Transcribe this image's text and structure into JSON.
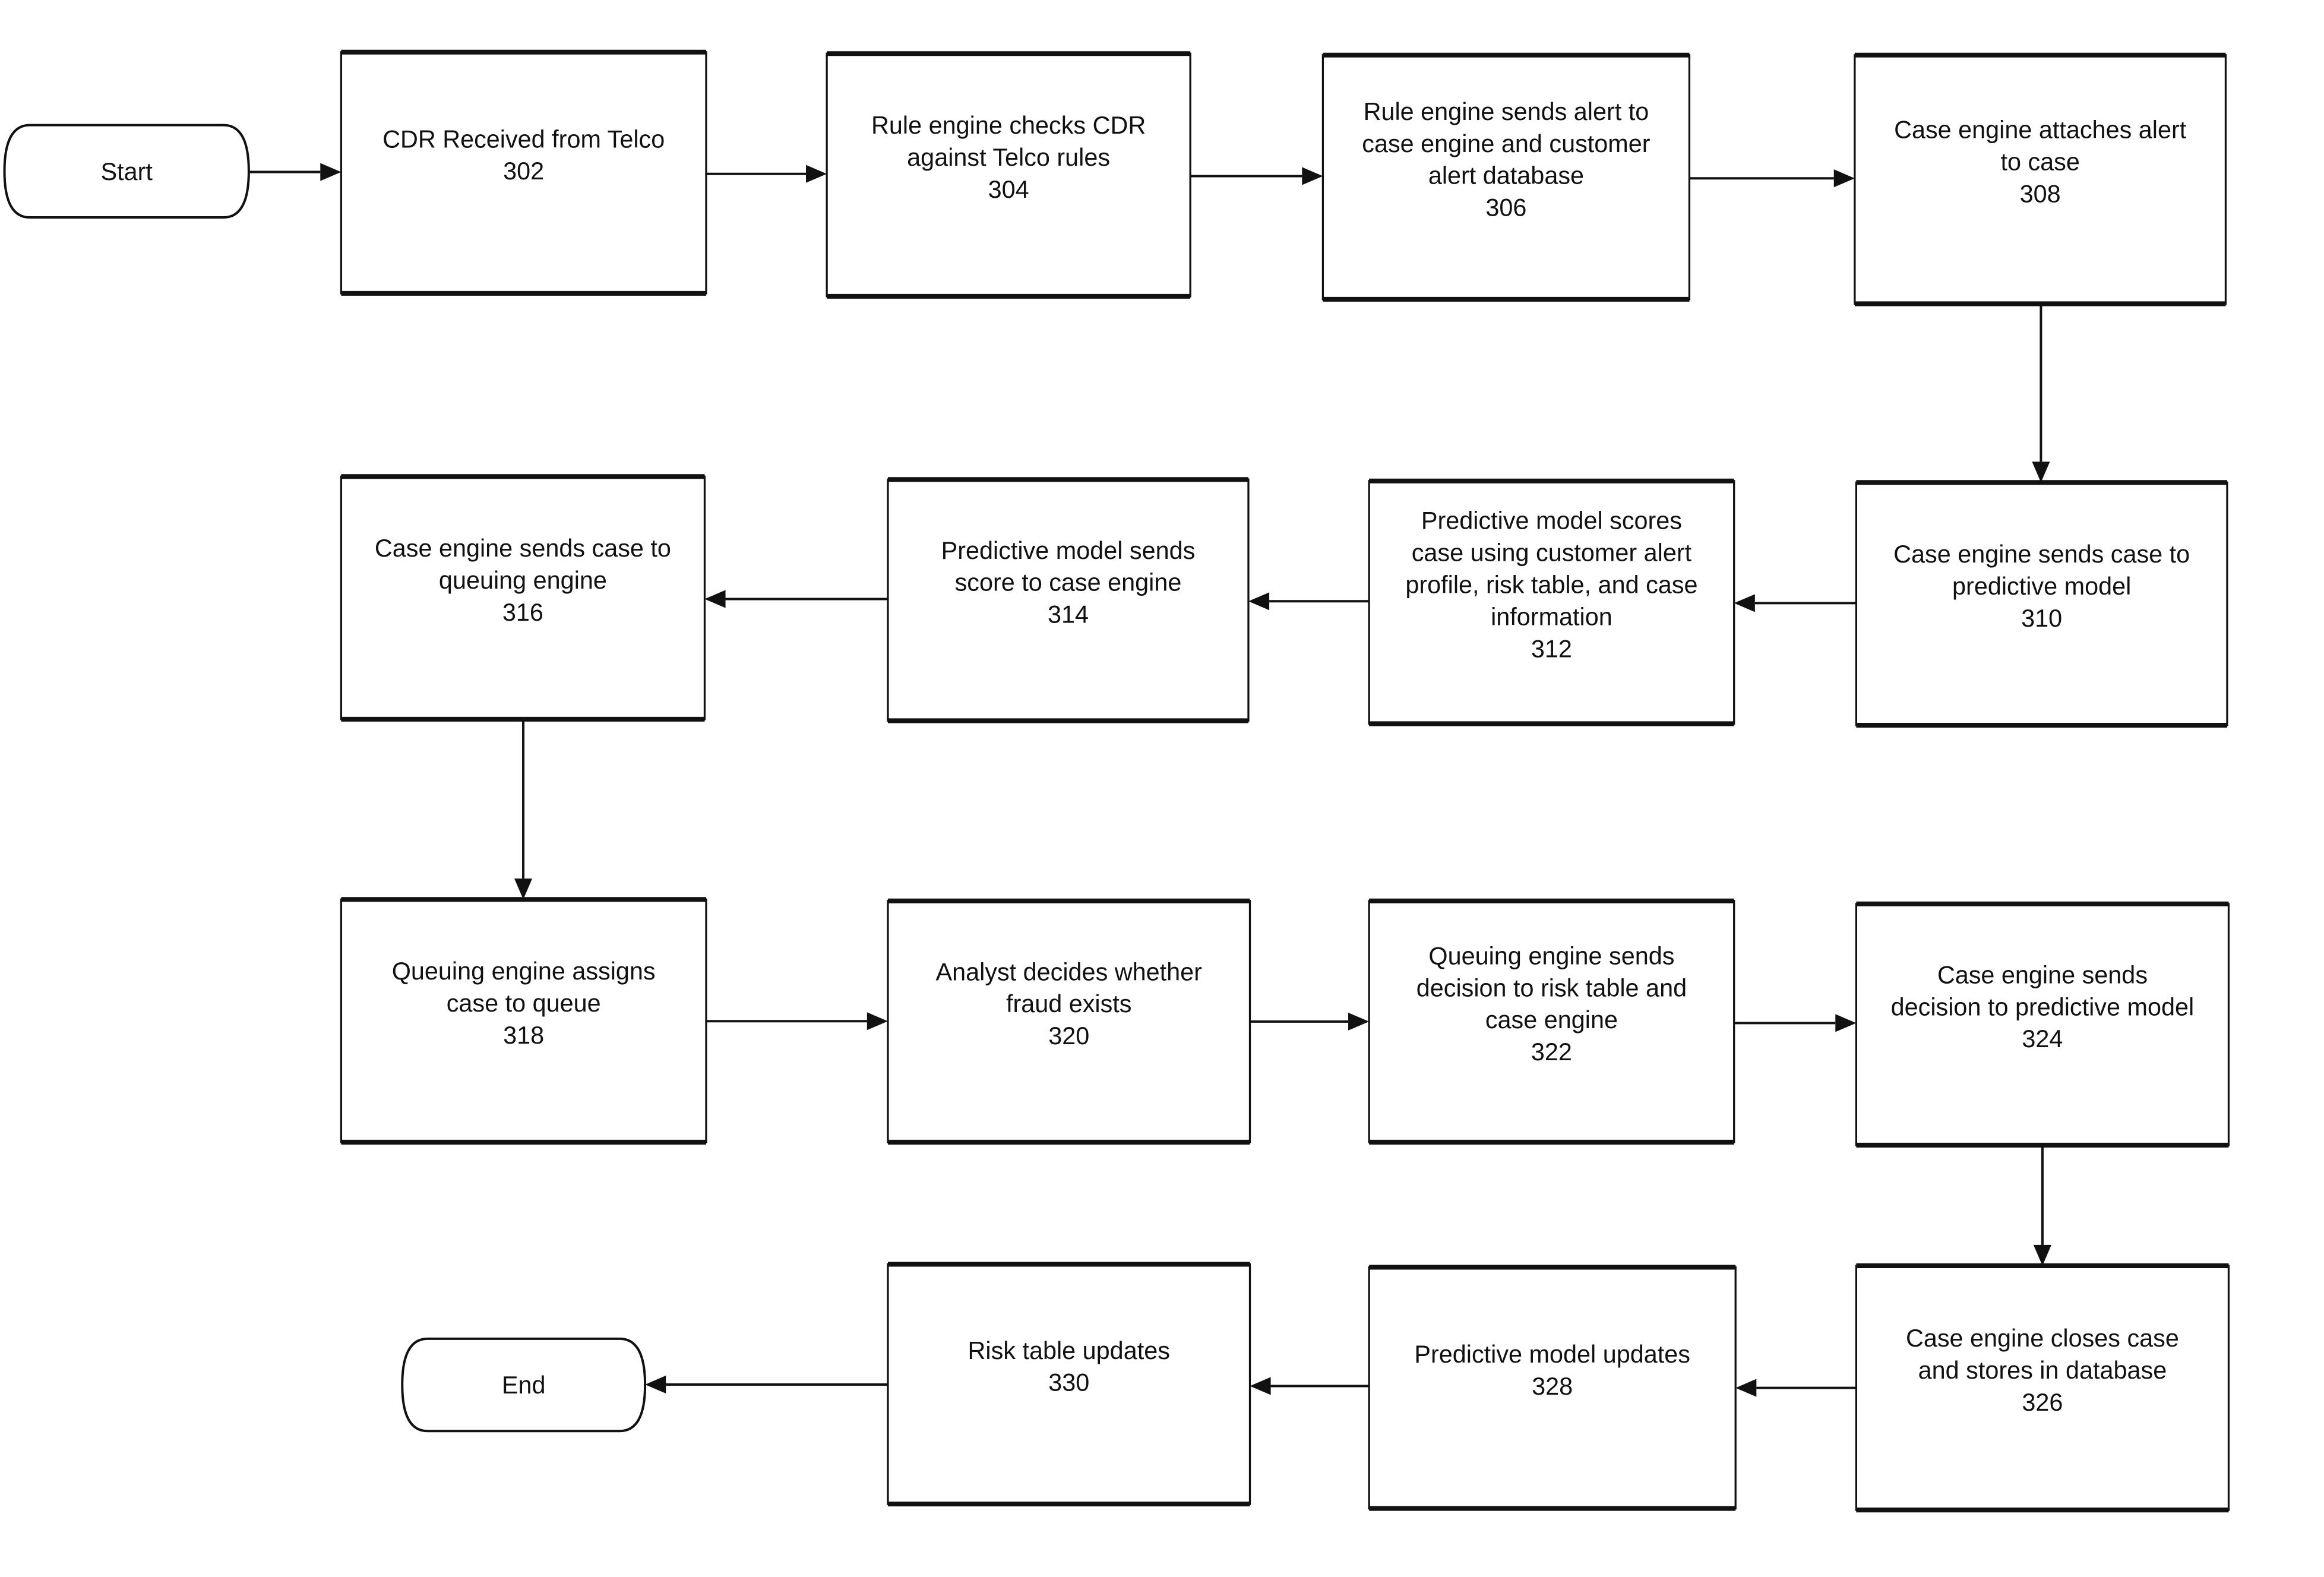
{
  "diagram": {
    "type": "flowchart",
    "terminals": {
      "start": {
        "label": "Start"
      },
      "end": {
        "label": "End"
      }
    },
    "steps": [
      {
        "id": "302",
        "lines": [
          "CDR Received from Telco"
        ],
        "number": "302"
      },
      {
        "id": "304",
        "lines": [
          "Rule engine checks CDR",
          "against Telco rules"
        ],
        "number": "304"
      },
      {
        "id": "306",
        "lines": [
          "Rule engine sends alert to",
          "case engine and customer",
          "alert database"
        ],
        "number": "306"
      },
      {
        "id": "308",
        "lines": [
          "Case engine attaches alert",
          "to case"
        ],
        "number": "308"
      },
      {
        "id": "310",
        "lines": [
          "Case engine sends case to",
          "predictive model"
        ],
        "number": "310"
      },
      {
        "id": "312",
        "lines": [
          "Predictive model scores",
          "case using customer alert",
          "profile, risk table, and case",
          "information"
        ],
        "number": "312"
      },
      {
        "id": "314",
        "lines": [
          "Predictive model sends",
          "score to case engine"
        ],
        "number": "314"
      },
      {
        "id": "316",
        "lines": [
          "Case engine sends case to",
          "queuing engine"
        ],
        "number": "316"
      },
      {
        "id": "318",
        "lines": [
          "Queuing engine assigns",
          "case to queue"
        ],
        "number": "318"
      },
      {
        "id": "320",
        "lines": [
          "Analyst decides whether",
          "fraud exists"
        ],
        "number": "320"
      },
      {
        "id": "322",
        "lines": [
          "Queuing engine sends",
          "decision to risk table and",
          "case engine"
        ],
        "number": "322"
      },
      {
        "id": "324",
        "lines": [
          "Case engine sends",
          "decision to predictive model"
        ],
        "number": "324"
      },
      {
        "id": "326",
        "lines": [
          "Case engine closes case",
          "and stores in database"
        ],
        "number": "326"
      },
      {
        "id": "328",
        "lines": [
          "Predictive model updates"
        ],
        "number": "328"
      },
      {
        "id": "330",
        "lines": [
          "Risk table updates"
        ],
        "number": "330"
      }
    ],
    "connections": [
      {
        "from": "start",
        "to": "302"
      },
      {
        "from": "302",
        "to": "304"
      },
      {
        "from": "304",
        "to": "306"
      },
      {
        "from": "306",
        "to": "308"
      },
      {
        "from": "308",
        "to": "310"
      },
      {
        "from": "310",
        "to": "312"
      },
      {
        "from": "312",
        "to": "314"
      },
      {
        "from": "314",
        "to": "316"
      },
      {
        "from": "316",
        "to": "318"
      },
      {
        "from": "318",
        "to": "320"
      },
      {
        "from": "320",
        "to": "322"
      },
      {
        "from": "322",
        "to": "324"
      },
      {
        "from": "324",
        "to": "326"
      },
      {
        "from": "326",
        "to": "328"
      },
      {
        "from": "328",
        "to": "330"
      },
      {
        "from": "330",
        "to": "end"
      }
    ]
  }
}
